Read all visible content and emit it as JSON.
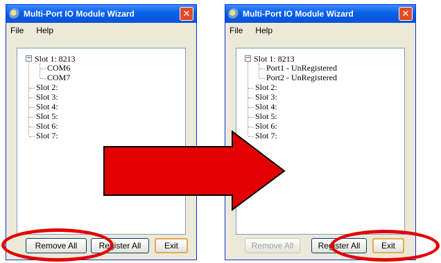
{
  "left_window": {
    "title": "Multi-Port IO Module Wizard",
    "menu": [
      "File",
      "Help"
    ],
    "tree": {
      "root": "Slot 1: 8213",
      "children": [
        "COM6",
        "COM7"
      ],
      "slots": [
        "Slot 2:",
        "Slot 3:",
        "Slot 4:",
        "Slot 5:",
        "Slot 6:",
        "Slot 7:"
      ]
    },
    "buttons": {
      "remove_all": "Remove All",
      "register_all": "Register All",
      "exit": "Exit"
    }
  },
  "right_window": {
    "title": "Multi-Port IO Module Wizard",
    "menu": [
      "File",
      "Help"
    ],
    "tree": {
      "root": "Slot 1: 8213",
      "children": [
        "Port1 - UnRegistered",
        "Port2 - UnRegistered"
      ],
      "slots": [
        "Slot 2:",
        "Slot 3:",
        "Slot 4:",
        "Slot 5:",
        "Slot 6:",
        "Slot 7:"
      ]
    },
    "buttons": {
      "remove_all": "Remove All",
      "register_all": "Register All",
      "exit": "Exit"
    }
  },
  "close_symbol": "✕",
  "colors": {
    "arrow": "#e30000",
    "highlight_ellipse": "#e30000",
    "titlebar": "#0a5fe8"
  }
}
